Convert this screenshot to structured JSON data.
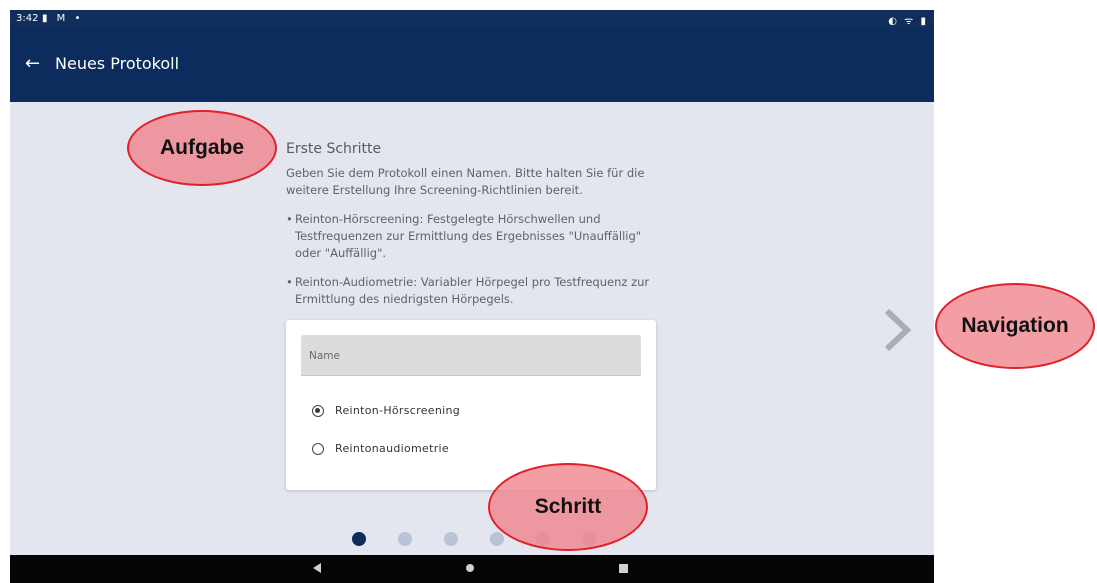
{
  "status_bar": {
    "time": "3:42",
    "left_icons": "▮ M •",
    "right_icons": "◐ ᯤ ▮"
  },
  "app_bar": {
    "back_icon": "arrow-left-icon",
    "back_glyph": "←",
    "title": "Neues Protokoll",
    "background": "#0d2c5e"
  },
  "step": {
    "title": "Erste Schritte",
    "intro": "Geben Sie dem Protokoll einen Namen. Bitte halten Sie für die weitere Erstellung Ihre Screening-Richtlinien bereit.",
    "bullets": [
      "Reinton-Hörscreening: Festgelegte Hörschwellen und Testfrequenzen zur Ermittlung des Ergebnisses \"Unauffällig\" oder \"Auffällig\".",
      "Reinton-Audiometrie: Variabler Hörpegel pro Testfrequenz zur Ermittlung des niedrigsten Hörpegels."
    ],
    "bullet_glyph": "•"
  },
  "form": {
    "name_placeholder": "Name",
    "options": [
      {
        "label": "Reinton-Hörscreening",
        "selected": true
      },
      {
        "label": "Reintonaudiometrie",
        "selected": false
      }
    ]
  },
  "pager": {
    "total": 6,
    "current": 1,
    "active_color": "#0f2d5b",
    "inactive_color": "#b8c3d6"
  },
  "navigation": {
    "next_icon": "chevron-right-icon"
  },
  "system_nav": {
    "back_icon": "triangle-back-icon",
    "home_icon": "circle-home-icon",
    "recent_icon": "square-recent-icon"
  },
  "annotations": {
    "task": "Aufgabe",
    "navigation": "Navigation",
    "step": "Schritt",
    "color": "#f0828c"
  }
}
